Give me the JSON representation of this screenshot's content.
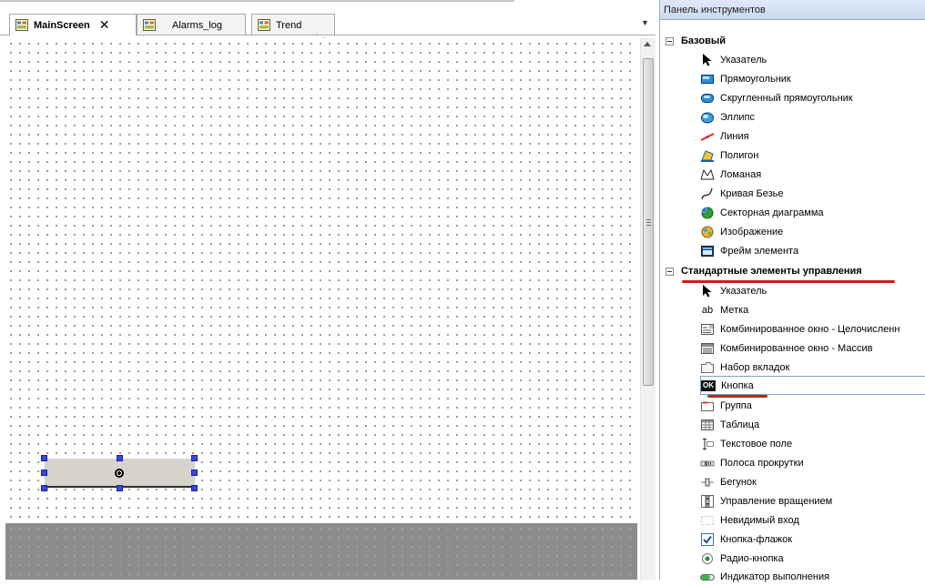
{
  "tabs": [
    {
      "label": "MainScreen",
      "active": true,
      "closable": true
    },
    {
      "label": "Alarms_log",
      "active": false
    },
    {
      "label": "Trend",
      "active": false
    }
  ],
  "toolbox": {
    "title": "Панель инструментов",
    "groups": [
      {
        "header": "Базовый",
        "items": [
          {
            "label": "Указатель",
            "icon": "pointer-icon"
          },
          {
            "label": "Прямоугольник",
            "icon": "rectangle-icon"
          },
          {
            "label": "Скругленный прямоугольник",
            "icon": "rounded-rectangle-icon"
          },
          {
            "label": "Эллипс",
            "icon": "ellipse-icon"
          },
          {
            "label": "Линия",
            "icon": "line-icon"
          },
          {
            "label": "Полигон",
            "icon": "polygon-icon"
          },
          {
            "label": "Ломаная",
            "icon": "polyline-icon"
          },
          {
            "label": "Кривая Безье",
            "icon": "bezier-icon"
          },
          {
            "label": "Секторная диаграмма",
            "icon": "pie-chart-icon"
          },
          {
            "label": "Изображение",
            "icon": "image-icon"
          },
          {
            "label": "Фрейм элемента",
            "icon": "frame-icon"
          }
        ]
      },
      {
        "header": "Стандартные элементы управления",
        "items": [
          {
            "label": "Указатель",
            "icon": "pointer-icon"
          },
          {
            "label": "Метка",
            "icon": "label-ab-icon",
            "glyph": "ab"
          },
          {
            "label": "Комбинированное окно - Целочисленн",
            "icon": "combobox-integer-icon"
          },
          {
            "label": "Комбинированное окно - Массив",
            "icon": "combobox-array-icon"
          },
          {
            "label": "Набор вкладок",
            "icon": "tab-control-icon"
          },
          {
            "label": "Кнопка",
            "icon": "button-ok-icon",
            "glyph": "OK",
            "selected": true
          },
          {
            "label": "Группа",
            "icon": "group-box-icon"
          },
          {
            "label": "Таблица",
            "icon": "table-icon"
          },
          {
            "label": "Текстовое поле",
            "icon": "text-field-icon"
          },
          {
            "label": "Полоса прокрутки",
            "icon": "scrollbar-icon"
          },
          {
            "label": "Бегунок",
            "icon": "slider-icon"
          },
          {
            "label": "Управление вращением",
            "icon": "spin-control-icon"
          },
          {
            "label": "Невидимый вход",
            "icon": "invisible-input-icon"
          },
          {
            "label": "Кнопка-флажок",
            "icon": "checkbox-icon"
          },
          {
            "label": "Радио-кнопка",
            "icon": "radio-button-icon"
          },
          {
            "label": "Индикатор выполнения",
            "icon": "progress-bar-icon"
          }
        ]
      }
    ]
  },
  "colors": {
    "annotation_red": "#d21a1a",
    "selection_handle": "#3a46e0",
    "selected_element_fill": "#d6d2cc"
  }
}
